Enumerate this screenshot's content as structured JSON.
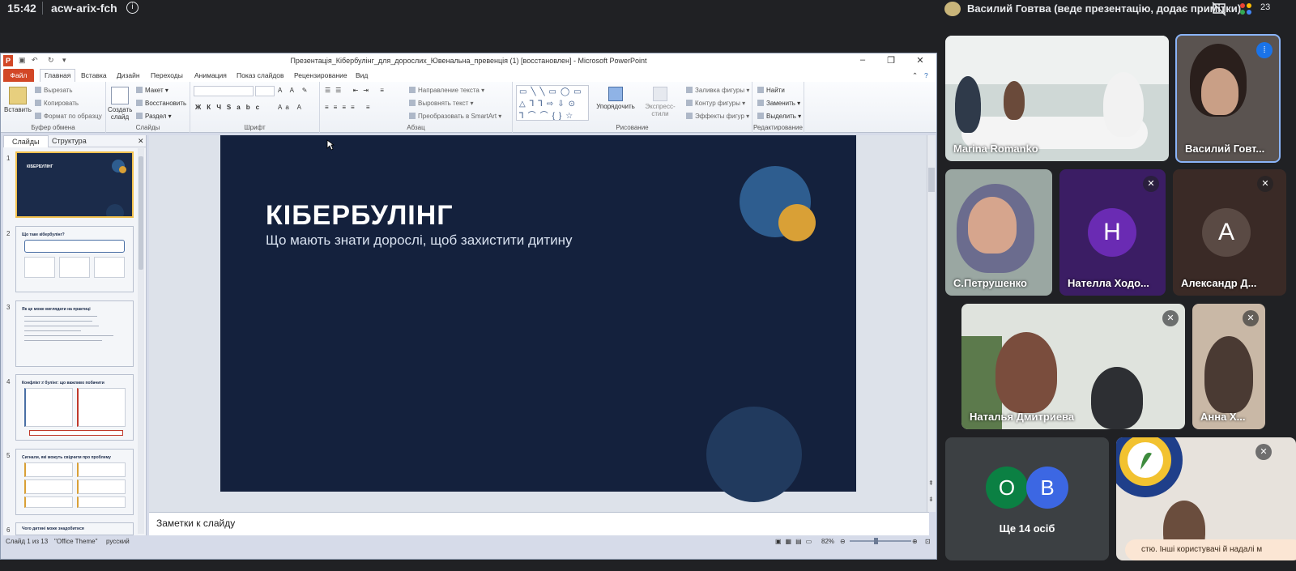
{
  "meet": {
    "time": "15:42",
    "meeting_code": "acw-arix-fch",
    "info_icon": "info-icon",
    "presenter_text": "Василий Говтва (веде презентацію, додає примітки)",
    "top_right_count": "23"
  },
  "ppt": {
    "window_title": "Презентація_Кібербулінг_для_дорослих_Ювенальна_превенція (1) [восстановлен] - Microsoft PowerPoint",
    "tabs": [
      "Файл",
      "Главная",
      "Вставка",
      "Дизайн",
      "Переходы",
      "Анимация",
      "Показ слайдов",
      "Рецензирование",
      "Вид"
    ],
    "ribbon": {
      "clipboard": {
        "paste": "Вставить",
        "cut": "Вырезать",
        "copy": "Копировать",
        "format_painter": "Формат по образцу",
        "label": "Буфер обмена"
      },
      "slides": {
        "new_slide": "Создать слайд",
        "layout": "Макет",
        "reset": "Восстановить",
        "section": "Раздел",
        "label": "Слайды"
      },
      "font": {
        "label": "Шрифт"
      },
      "paragraph": {
        "text_direction": "Направление текста",
        "align_text": "Выровнять текст",
        "smartart": "Преобразовать в SmartArt",
        "label": "Абзац"
      },
      "drawing": {
        "arrange": "Упорядочить",
        "quick_styles": "Экспресс-стили",
        "shape_fill": "Заливка фигуры",
        "shape_outline": "Контур фигуры",
        "shape_effects": "Эффекты фигур",
        "label": "Рисование"
      },
      "editing": {
        "find": "Найти",
        "replace": "Заменить",
        "select": "Выделить",
        "label": "Редактирование"
      }
    },
    "panel_tabs": [
      "Слайды",
      "Структура"
    ],
    "thumbnails": [
      {
        "num": "1",
        "title": "КІБЕРБУЛІНГ"
      },
      {
        "num": "2",
        "title": "Що таке кібербулінг?"
      },
      {
        "num": "3",
        "title": "Як це може виглядати на практиці"
      },
      {
        "num": "4",
        "title": "Конфлікт ≠ булінг: що важливо побачити"
      },
      {
        "num": "5",
        "title": "Сигнали, які можуть свідчити про проблему"
      },
      {
        "num": "6",
        "title": "Чого дитині може знадобитися"
      }
    ],
    "slide": {
      "title": "КІБЕРБУЛІНГ",
      "subtitle": "Що мають знати дорослі, щоб захистити дитину"
    },
    "notes_placeholder": "Заметки к слайду",
    "status": {
      "slide_counter": "Слайд 1 из 13",
      "theme": "\"Office Theme\"",
      "language": "русский",
      "zoom": "82%"
    }
  },
  "participants": [
    {
      "name": "Marina Romanko"
    },
    {
      "name": "Василий Говт..."
    },
    {
      "name": "С.Петрушенко"
    },
    {
      "name": "Нателла Ходо...",
      "initial": "Н"
    },
    {
      "name": "Александр Д...",
      "initial": "А"
    },
    {
      "name": "Наталья Дмитриева"
    },
    {
      "name": "Анна Х..."
    },
    {
      "name": "Ще 14 осіб",
      "initials": [
        "О",
        "В"
      ]
    }
  ],
  "toast": "стю. Інші користувачі й надалі м",
  "colors": {
    "slide_bg": "#14213d",
    "circle_blue": "#2e5d8f",
    "circle_gold": "#d9a036",
    "file_tab": "#d24726",
    "avatar_purple": "#6a2bb3",
    "avatar_brown": "#5a4a44",
    "avatar_teal": "#0b8043",
    "avatar_blue": "#3c67e3"
  }
}
